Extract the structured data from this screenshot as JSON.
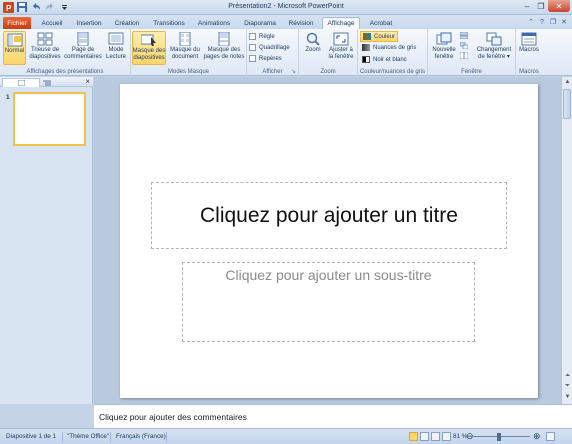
{
  "window": {
    "title": "Présentation2 - Microsoft PowerPoint"
  },
  "tabs": [
    {
      "label": "Fichier"
    },
    {
      "label": "Accueil"
    },
    {
      "label": "Insertion"
    },
    {
      "label": "Création"
    },
    {
      "label": "Transitions"
    },
    {
      "label": "Animations"
    },
    {
      "label": "Diaporama"
    },
    {
      "label": "Révision"
    },
    {
      "label": "Affichage"
    },
    {
      "label": "Acrobat"
    }
  ],
  "ribbon": {
    "presentation_views": {
      "label": "Affichages des présentations",
      "normal": "Normal",
      "trieuse": [
        "Trieuse de",
        "diapositives"
      ],
      "page_commentaires": [
        "Page de",
        "commentaires"
      ],
      "mode_lecture": [
        "Mode",
        "Lecture"
      ]
    },
    "master_views": {
      "label": "Modes Masque",
      "masque_diapositives": [
        "Masque des",
        "diapositives"
      ],
      "masque_document": [
        "Masque du",
        "document"
      ],
      "masque_pages": [
        "Masque des",
        "pages de notes"
      ]
    },
    "show": {
      "label": "Afficher",
      "regle": "Règle",
      "quadrillage": "Quadrillage",
      "reperes": "Repères"
    },
    "zoom": {
      "label": "Zoom",
      "zoom": "Zoom",
      "ajuster": [
        "Ajuster à",
        "la fenêtre"
      ]
    },
    "color": {
      "label": "Couleur/nuances de gris",
      "couleur": "Couleur",
      "nuances": "Nuances de gris",
      "noir_blanc": "Noir et blanc"
    },
    "window": {
      "label": "Fenêtre",
      "nouvelle": [
        "Nouvelle",
        "fenêtre"
      ],
      "changement": [
        "Changement",
        "de fenêtre ▾"
      ]
    },
    "macros": {
      "label": "Macros",
      "macros": "Macros"
    }
  },
  "slides_pane": {
    "slide_number": "1"
  },
  "slide": {
    "title_placeholder": "Cliquez pour ajouter un titre",
    "subtitle_placeholder": "Cliquez pour ajouter un sous-titre"
  },
  "notes": {
    "placeholder": "Cliquez pour ajouter des commentaires"
  },
  "status": {
    "slide_info": "Diapositive 1 de 1",
    "theme": "\"Thème Office\"",
    "language": "Français (France)",
    "zoom": "81 %"
  }
}
